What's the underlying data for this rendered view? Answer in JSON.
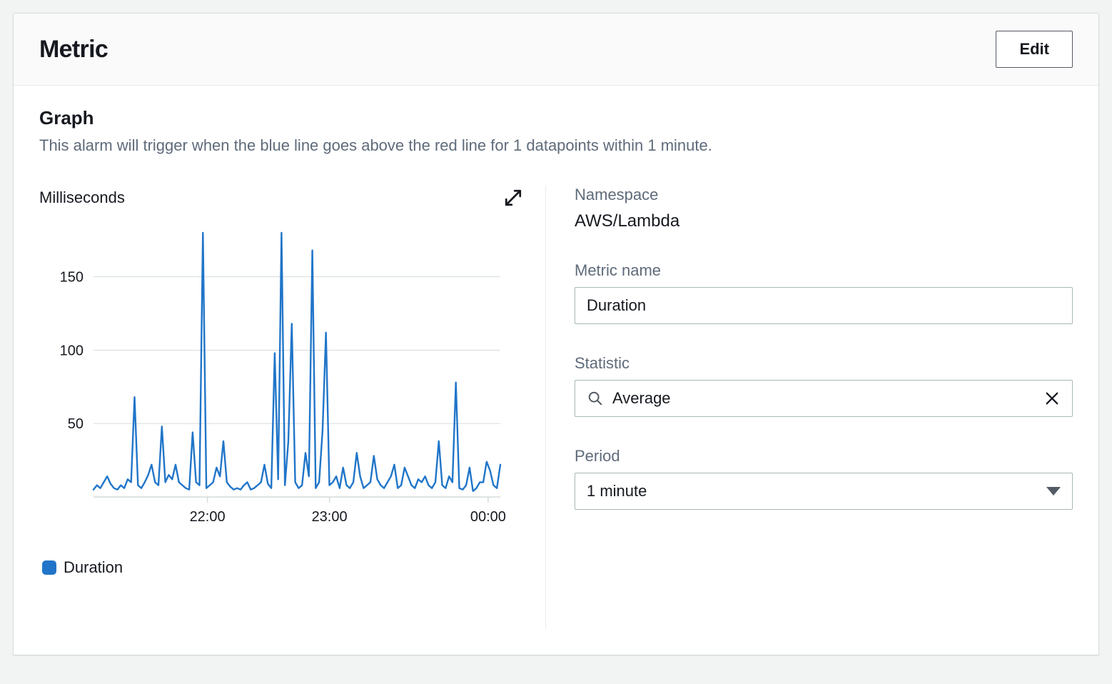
{
  "header": {
    "title": "Metric",
    "edit_label": "Edit"
  },
  "graph": {
    "title": "Graph",
    "description": "This alarm will trigger when the blue line goes above the red line for 1 datapoints within 1 minute.",
    "y_unit_label": "Milliseconds",
    "legend_label": "Duration"
  },
  "form": {
    "namespace_label": "Namespace",
    "namespace_value": "AWS/Lambda",
    "metric_name_label": "Metric name",
    "metric_name_value": "Duration",
    "statistic_label": "Statistic",
    "statistic_value": "Average",
    "period_label": "Period",
    "period_value": "1 minute"
  },
  "colors": {
    "series": "#2075c9",
    "grid": "#d5dbdb",
    "axis_text": "#687078"
  },
  "chart_data": {
    "type": "line",
    "ylabel": "Milliseconds",
    "title": "Duration",
    "ylim": [
      0,
      180
    ],
    "y_ticks": [
      50,
      100,
      150
    ],
    "x_ticks": [
      "22:00",
      "23:00",
      "00:00"
    ],
    "series": [
      {
        "name": "Duration",
        "color": "#2075c9",
        "values": [
          5,
          8,
          6,
          10,
          14,
          9,
          6,
          5,
          8,
          6,
          12,
          10,
          68,
          8,
          6,
          10,
          15,
          22,
          10,
          8,
          48,
          10,
          15,
          12,
          22,
          10,
          8,
          6,
          5,
          44,
          10,
          8,
          184,
          6,
          8,
          10,
          20,
          14,
          38,
          10,
          7,
          5,
          6,
          5,
          8,
          10,
          5,
          6,
          8,
          10,
          22,
          9,
          6,
          98,
          12,
          184,
          8,
          38,
          118,
          10,
          6,
          8,
          30,
          14,
          168,
          6,
          10,
          45,
          112,
          8,
          10,
          14,
          6,
          20,
          8,
          6,
          10,
          30,
          14,
          6,
          8,
          10,
          28,
          12,
          8,
          6,
          10,
          14,
          22,
          6,
          8,
          20,
          14,
          8,
          6,
          12,
          10,
          14,
          8,
          6,
          10,
          38,
          8,
          6,
          14,
          10,
          78,
          6,
          5,
          8,
          20,
          4,
          6,
          10,
          10,
          24,
          18,
          8,
          6,
          22
        ]
      }
    ]
  }
}
